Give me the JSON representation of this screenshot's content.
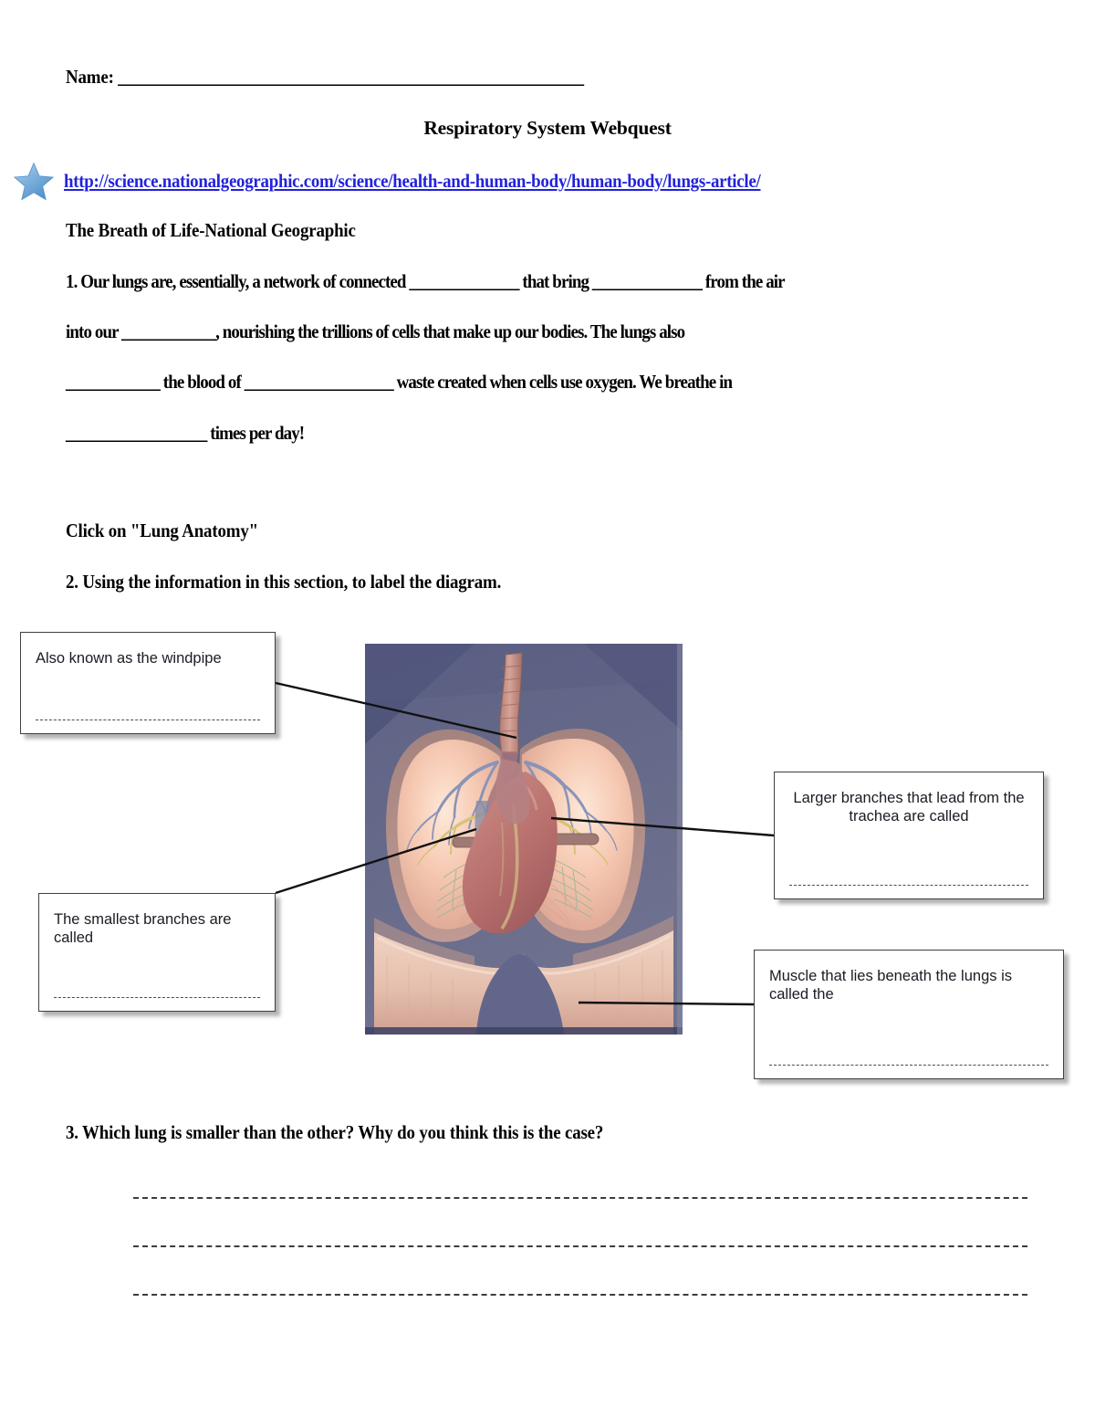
{
  "header": {
    "name_label": "Name: _______________________________________________________",
    "title": "Respiratory System Webquest",
    "star_icon": "star-icon",
    "url": "http://science.nationalgeographic.com/science/health-and-human-body/human-body/lungs-article/",
    "url_color": "#2222dd"
  },
  "section1": {
    "heading": "The Breath of Life-National Geographic",
    "line1": "1. Our lungs are, essentially, a network of connected ______________ that bring ______________ from the air",
    "line2": "into our ____________, nourishing the trillions of cells that make up our bodies. The lungs also",
    "line3": "____________ the blood of ___________________ waste created when cells use oxygen. We breathe in",
    "line4": "__________________ times per day!"
  },
  "section2": {
    "heading": "Click on \"Lung Anatomy\"",
    "instruction": "2. Using the information in this section, to label the diagram."
  },
  "diagram": {
    "figure_alt": "human-lungs-anatomy-illustration",
    "background_color": "#6a6d8c",
    "callouts": [
      {
        "id": "trachea",
        "text": "Also known as the windpipe",
        "align": "left"
      },
      {
        "id": "bronchi",
        "text": "Larger branches that lead from the trachea are called",
        "align": "center"
      },
      {
        "id": "alveoli",
        "text": "The smallest branches are called",
        "align": "left"
      },
      {
        "id": "diaphragm",
        "text": "Muscle that lies beneath the lungs is called the",
        "align": "left"
      }
    ]
  },
  "section3": {
    "question": "3. Which lung is smaller than the other? Why do you think this is the case?",
    "answer_lines": 3
  }
}
